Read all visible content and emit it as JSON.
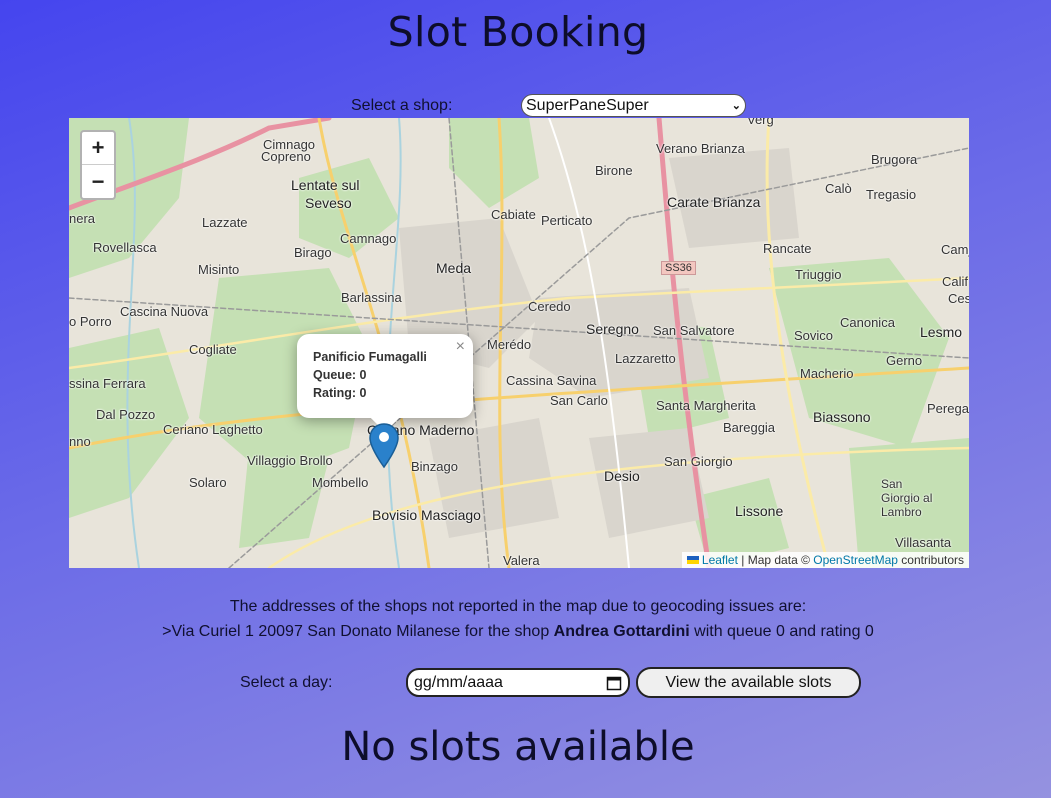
{
  "page": {
    "title": "Slot Booking"
  },
  "shop_select": {
    "label": "Select a shop:",
    "selected": "SuperPaneSuper"
  },
  "map": {
    "places": [
      {
        "name": "Cimnago"
      },
      {
        "name": "Copreno"
      },
      {
        "name": "Lentate sul"
      },
      {
        "name": "Seveso"
      },
      {
        "name": "Lazzate"
      },
      {
        "name": "Camnago"
      },
      {
        "name": "Birago"
      },
      {
        "name": "Misinto"
      },
      {
        "name": "Rovellasca"
      },
      {
        "name": "Barlassina"
      },
      {
        "name": "Meda"
      },
      {
        "name": "Cabiate"
      },
      {
        "name": "Perticato"
      },
      {
        "name": "Ceredo"
      },
      {
        "name": "Cascina Nuova"
      },
      {
        "name": "Cogliate"
      },
      {
        "name": "Merédo"
      },
      {
        "name": "Seregno"
      },
      {
        "name": "San Salvatore"
      },
      {
        "name": "Lazzaretto"
      },
      {
        "name": "Cassina Savina"
      },
      {
        "name": "San Carlo"
      },
      {
        "name": "Santa Margherita"
      },
      {
        "name": "Bareggia"
      },
      {
        "name": "Biassono"
      },
      {
        "name": "Macherio"
      },
      {
        "name": "Sovico"
      },
      {
        "name": "Canonica"
      },
      {
        "name": "Lesmo"
      },
      {
        "name": "Gerno"
      },
      {
        "name": "Peregal"
      },
      {
        "name": "Verano Brianza"
      },
      {
        "name": "Birone"
      },
      {
        "name": "Carate Brianza"
      },
      {
        "name": "Brugora"
      },
      {
        "name": "Calò"
      },
      {
        "name": "Tregasio"
      },
      {
        "name": "Rancate"
      },
      {
        "name": "Triuggio"
      },
      {
        "name": "Camj"
      },
      {
        "name": "Calif"
      },
      {
        "name": "Cesana"
      },
      {
        "name": "Ceriano Laghetto"
      },
      {
        "name": "Cesano Maderno"
      },
      {
        "name": "Villaggio Brollo"
      },
      {
        "name": "Binzago"
      },
      {
        "name": "Solaro"
      },
      {
        "name": "Mombello"
      },
      {
        "name": "Bovisio Masciago"
      },
      {
        "name": "Desio"
      },
      {
        "name": "San Giorgio"
      },
      {
        "name": "Lissone"
      },
      {
        "name": "Dal Pozzo"
      },
      {
        "name": "ssina Ferrara"
      },
      {
        "name": "o Porro"
      },
      {
        "name": "nera"
      },
      {
        "name": "nno"
      },
      {
        "name": "San Giorgio al Lambro"
      },
      {
        "name": "Villasanta"
      },
      {
        "name": "Valera"
      },
      {
        "name": "Verg"
      },
      {
        "name": "SS36"
      }
    ],
    "zoom_in": "+",
    "zoom_out": "−",
    "popup": {
      "name": "Panificio Fumagalli",
      "queue": "Queue: 0",
      "rating": "Rating: 0",
      "close": "×"
    },
    "attribution": {
      "leaflet": "Leaflet",
      "mid": " | Map data © ",
      "osm": "OpenStreetMap",
      "tail": " contributors"
    }
  },
  "geocoding": {
    "intro": "The addresses of the shops not reported in the map due to geocoding issues are:",
    "prefix": ">Via Curiel 1 20097 San Donato Milanese for the shop ",
    "shop": "Andrea Gottardini",
    "suffix": " with queue 0 and rating 0"
  },
  "day_select": {
    "label": "Select a day:",
    "placeholder": "gg/mm/aaaa",
    "button": "View the available slots"
  },
  "result": {
    "message": "No slots available"
  },
  "colors": {
    "accent_link": "#0078a8",
    "marker": "#2a81cb"
  }
}
